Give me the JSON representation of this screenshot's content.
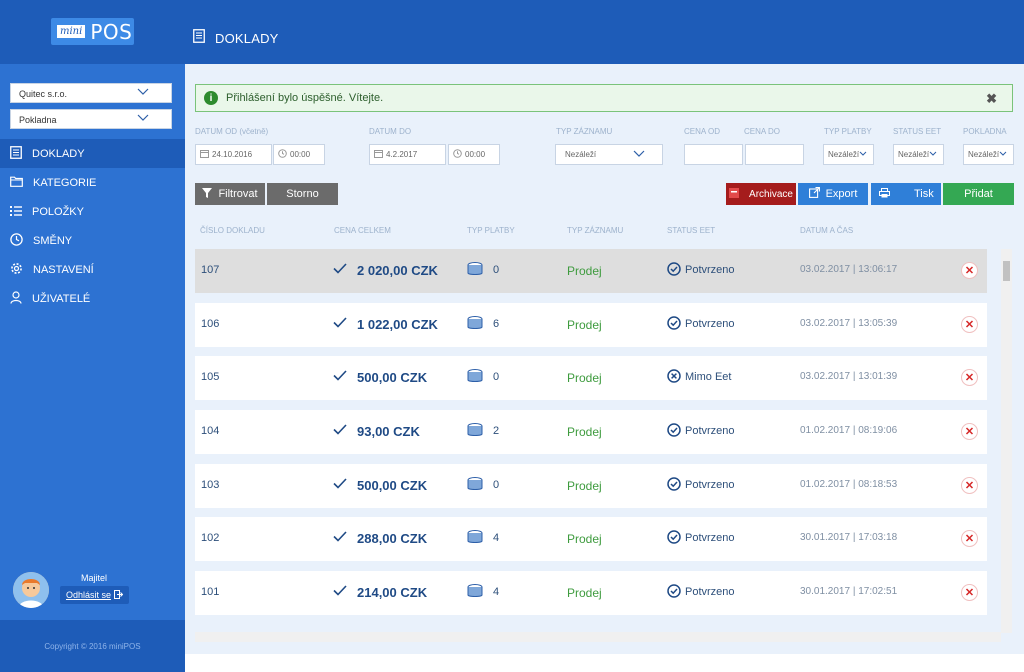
{
  "app": {
    "logo_mini": "mini",
    "logo_pos": "POS",
    "page_title": "DOKLADY"
  },
  "sidebar": {
    "company": "Quitec s.r.o.",
    "register": "Pokladna",
    "items": [
      {
        "label": "DOKLADY",
        "icon": "document-icon",
        "active": true
      },
      {
        "label": "KATEGORIE",
        "icon": "folder-icon",
        "active": false
      },
      {
        "label": "POLOŽKY",
        "icon": "list-icon",
        "active": false
      },
      {
        "label": "SMĚNY",
        "icon": "clock-icon",
        "active": false
      },
      {
        "label": "NASTAVENÍ",
        "icon": "gear-icon",
        "active": false
      },
      {
        "label": "UŽIVATELÉ",
        "icon": "user-icon",
        "active": false
      }
    ],
    "user_role": "Majitel",
    "logout": "Odhlásit se",
    "copyright": "Copyright © 2016 miniPOS"
  },
  "alert": {
    "text": "Přihlášení bylo úspěšné. Vítejte.",
    "close": "✖"
  },
  "filters": {
    "date_from_label": "DATUM OD",
    "date_from_hint": "(včetně)",
    "date_from": "24.10.2016",
    "time_from": "00:00",
    "date_to_label": "DATUM DO",
    "date_to": "4.2.2017",
    "time_to": "00:00",
    "record_type_label": "TYP ZÁZNAMU",
    "record_type": "Nezáleží",
    "price_from_label": "CENA OD",
    "price_to_label": "CENA DO",
    "payment_type_label": "TYP PLATBY",
    "payment_type": "Nezáleží",
    "eet_status_label": "STATUS EET",
    "eet_status": "Nezáleží",
    "register_label": "POKLADNA",
    "register": "Nezáleží"
  },
  "buttons": {
    "filter": "Filtrovat",
    "cancel": "Storno",
    "archive": "Archivace",
    "export": "Export",
    "print": "Tisk",
    "add": "Přidat"
  },
  "colors": {
    "archive": "#a51c1c",
    "export": "#2f7fd8",
    "print": "#2f7fd8",
    "add": "#34a853",
    "filter": "#6b6b6b"
  },
  "table": {
    "headers": [
      "ČÍSLO DOKLADU",
      "CENA CELKEM",
      "TYP PLATBY",
      "TYP ZÁZNAMU",
      "STATUS EET",
      "DATUM A ČAS"
    ],
    "rows": [
      {
        "number": "107",
        "price": "2 020,00 CZK",
        "payment": "0",
        "type": "Prodej",
        "eet": "Potvrzeno",
        "eet_ok": true,
        "datetime": "03.02.2017 | 13:06:17"
      },
      {
        "number": "106",
        "price": "1 022,00 CZK",
        "payment": "6",
        "type": "Prodej",
        "eet": "Potvrzeno",
        "eet_ok": true,
        "datetime": "03.02.2017 | 13:05:39"
      },
      {
        "number": "105",
        "price": "500,00 CZK",
        "payment": "0",
        "type": "Prodej",
        "eet": "Mimo Eet",
        "eet_ok": false,
        "datetime": "03.02.2017 | 13:01:39"
      },
      {
        "number": "104",
        "price": "93,00 CZK",
        "payment": "2",
        "type": "Prodej",
        "eet": "Potvrzeno",
        "eet_ok": true,
        "datetime": "01.02.2017 | 08:19:06"
      },
      {
        "number": "103",
        "price": "500,00 CZK",
        "payment": "0",
        "type": "Prodej",
        "eet": "Potvrzeno",
        "eet_ok": true,
        "datetime": "01.02.2017 | 08:18:53"
      },
      {
        "number": "102",
        "price": "288,00 CZK",
        "payment": "4",
        "type": "Prodej",
        "eet": "Potvrzeno",
        "eet_ok": true,
        "datetime": "30.01.2017 | 17:03:18"
      },
      {
        "number": "101",
        "price": "214,00 CZK",
        "payment": "4",
        "type": "Prodej",
        "eet": "Potvrzeno",
        "eet_ok": true,
        "datetime": "30.01.2017 | 17:02:51"
      }
    ]
  }
}
